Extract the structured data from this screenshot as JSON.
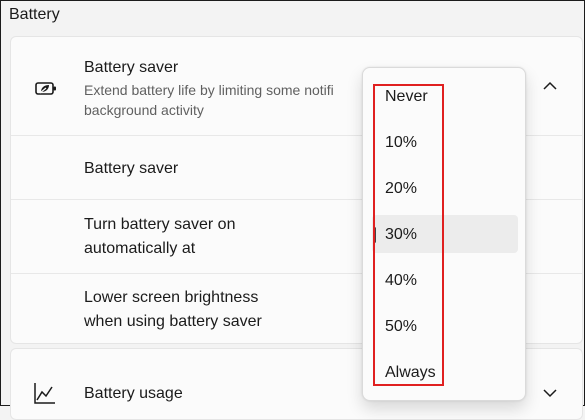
{
  "section": {
    "title": "Battery"
  },
  "battery_saver_card": {
    "header": {
      "title": "Battery saver",
      "description_line1": "Extend battery life by limiting some notifi",
      "description_line2": "background activity"
    },
    "rows": [
      {
        "label": "Battery saver"
      },
      {
        "label_line1": "Turn battery saver on",
        "label_line2": "automatically at"
      },
      {
        "label_line1": "Lower screen brightness",
        "label_line2": "when using battery saver"
      }
    ]
  },
  "battery_usage": {
    "title": "Battery usage"
  },
  "dropdown": {
    "options": [
      "Never",
      "10%",
      "20%",
      "30%",
      "40%",
      "50%",
      "Always"
    ],
    "selected": "30%"
  },
  "colors": {
    "highlight": "#e02020",
    "accent": "#0a7d6e"
  },
  "icons": {
    "battery_saver": "battery-leaf-icon",
    "usage": "line-chart-icon",
    "collapse": "chevron-up-icon",
    "expand": "chevron-down-icon"
  }
}
